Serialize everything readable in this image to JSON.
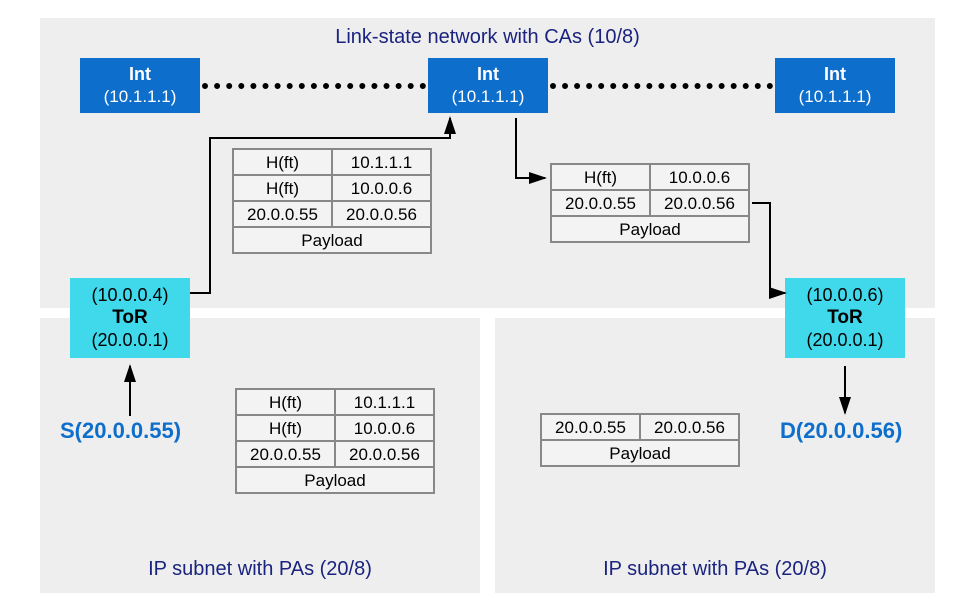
{
  "titles": {
    "top": "Link-state network with CAs (10/8)",
    "bl": "IP subnet with PAs (20/8)",
    "br": "IP subnet with PAs (20/8)"
  },
  "int_nodes": {
    "label": "Int",
    "ip": "(10.1.1.1)"
  },
  "tor_left": {
    "top_ip": "(10.0.0.4)",
    "label": "ToR",
    "bottom_ip": "(20.0.0.1)"
  },
  "tor_right": {
    "top_ip": "(10.0.0.6)",
    "label": "ToR",
    "bottom_ip": "(20.0.0.1)"
  },
  "endpoints": {
    "src": "S(20.0.0.55)",
    "dst": "D(20.0.0.56)"
  },
  "packets": {
    "top_left": {
      "r1a": "H(ft)",
      "r1b": "10.1.1.1",
      "r2a": "H(ft)",
      "r2b": "10.0.0.6",
      "r3a": "20.0.0.55",
      "r3b": "20.0.0.56",
      "payload": "Payload"
    },
    "top_right": {
      "r1a": "H(ft)",
      "r1b": "10.0.0.6",
      "r2a": "20.0.0.55",
      "r2b": "20.0.0.56",
      "payload": "Payload"
    },
    "bottom_left": {
      "r1a": "H(ft)",
      "r1b": "10.1.1.1",
      "r2a": "H(ft)",
      "r2b": "10.0.0.6",
      "r3a": "20.0.0.55",
      "r3b": "20.0.0.56",
      "payload": "Payload"
    },
    "bottom_right": {
      "r1a": "20.0.0.55",
      "r1b": "20.0.0.56",
      "payload": "Payload"
    }
  }
}
